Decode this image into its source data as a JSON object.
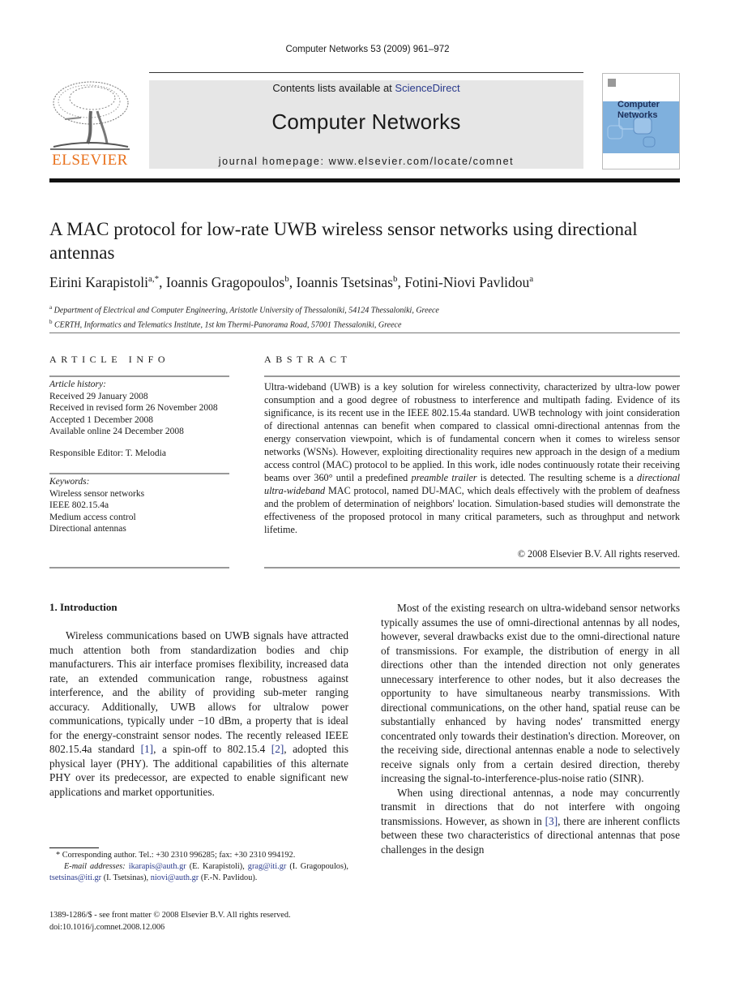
{
  "running_head": "Computer Networks 53 (2009) 961–972",
  "masthead": {
    "contents_prefix": "Contents lists available at ",
    "contents_link": "ScienceDirect",
    "journal_name": "Computer Networks",
    "homepage": "journal homepage: www.elsevier.com/locate/comnet",
    "publisher_logo_text": "ELSEVIER",
    "cover_title_line1": "Computer",
    "cover_title_line2": "Networks",
    "accent_color": "#e9711c",
    "link_color": "#2a3a8c"
  },
  "article": {
    "title": "A MAC protocol for low-rate UWB wireless sensor networks using directional antennas",
    "authors": [
      {
        "name": "Eirini Karapistoli",
        "sup": "a,*"
      },
      {
        "name": "Ioannis Gragopoulos",
        "sup": "b"
      },
      {
        "name": "Ioannis Tsetsinas",
        "sup": "b"
      },
      {
        "name": "Fotini-Niovi Pavlidou",
        "sup": "a"
      }
    ],
    "affiliations": [
      {
        "label": "a",
        "text": "Department of Electrical and Computer Engineering, Aristotle University of Thessaloniki, 54124 Thessaloniki, Greece"
      },
      {
        "label": "b",
        "text": "CERTH, Informatics and Telematics Institute, 1st km Thermi-Panorama Road, 57001 Thessaloniki, Greece"
      }
    ]
  },
  "article_info": {
    "heading": "ARTICLE INFO",
    "history_label": "Article history:",
    "history": [
      "Received 29 January 2008",
      "Received in revised form 26 November 2008",
      "Accepted 1 December 2008",
      "Available online 24 December 2008"
    ],
    "editor": "Responsible Editor: T. Melodia",
    "keywords_label": "Keywords:",
    "keywords": [
      "Wireless sensor networks",
      "IEEE 802.15.4a",
      "Medium access control",
      "Directional antennas"
    ]
  },
  "abstract": {
    "heading": "ABSTRACT",
    "part1": "Ultra-wideband (UWB) is a key solution for wireless connectivity, characterized by ultra-low power consumption and a good degree of robustness to interference and multipath fading. Evidence of its significance, is its recent use in the IEEE 802.15.4a standard. UWB technology with joint consideration of directional antennas can benefit when compared to classical omni-directional antennas from the energy conservation viewpoint, which is of fundamental concern when it comes to wireless sensor networks (WSNs). However, exploiting directionality requires new approach in the design of a medium access control (MAC) protocol to be applied. In this work, idle nodes continuously rotate their receiving beams over 360° until a predefined ",
    "italic1": "preamble trailer",
    "part2": " is detected. The resulting scheme is a ",
    "italic2": "directional ultra-wideband",
    "part3": " MAC protocol, named DU-MAC, which deals effectively with the problem of deafness and the problem of determination of neighbors' location. Simulation-based studies will demonstrate the effectiveness of the proposed protocol in many critical parameters, such as throughput and network lifetime.",
    "copyright": "© 2008 Elsevier B.V. All rights reserved."
  },
  "introduction": {
    "heading": "1.  Introduction",
    "left_p1_a": "Wireless communications based on UWB signals have attracted much attention both from standardization bodies and chip manufacturers. This air interface promises flexibility, increased data rate, an extended communication range, robustness against interference, and the ability of providing sub-meter ranging accuracy. Additionally, UWB allows for ultralow power communications, typically under −10 dBm, a property that is ideal for the energy-constraint sensor nodes. The recently released IEEE 802.15.4a standard ",
    "ref1": "[1]",
    "left_p1_b": ", a spin-off to 802.15.4 ",
    "ref2": "[2]",
    "left_p1_c": ", adopted this physical layer (PHY). The additional capabilities of this alternate PHY over its predecessor, are expected to enable significant new applications and market opportunities.",
    "right_p1": "Most of the existing research on ultra-wideband sensor networks typically assumes the use of omni-directional antennas by all nodes, however, several drawbacks exist due to the omni-directional nature of transmissions. For example, the distribution of energy in all directions other than the intended direction not only generates unnecessary interference to other nodes, but it also decreases the opportunity to have simultaneous nearby transmissions. With directional communications, on the other hand, spatial reuse can be substantially enhanced by having nodes' transmitted energy concentrated only towards their destination's direction. Moreover, on the receiving side, directional antennas enable a node to selectively receive signals only from a certain desired direction, thereby increasing the signal-to-interference-plus-noise ratio (SINR).",
    "right_p2_a": "When using directional antennas, a node may concurrently transmit in directions that do not interfere with ongoing transmissions. However, as shown in ",
    "ref3": "[3]",
    "right_p2_b": ", there are inherent conflicts between these two characteristics of directional antennas that pose challenges in the design"
  },
  "footnotes": {
    "corresponding": "* Corresponding author. Tel.: +30 2310 996285; fax: +30 2310 994192.",
    "email_label": "E-mail addresses:",
    "emails": [
      {
        "address": "ikarapis@auth.gr",
        "name": "(E. Karapistoli)"
      },
      {
        "address": "grag@iti.gr",
        "name": "(I. Gragopoulos)"
      },
      {
        "address": "tsetsinas@iti.gr",
        "name": "(I. Tsetsinas)"
      },
      {
        "address": "niovi@auth.gr",
        "name": "(F.-N. Pavlidou)"
      }
    ],
    "issn": "1389-1286/$ - see front matter © 2008 Elsevier B.V. All rights reserved.",
    "doi": "doi:10.1016/j.comnet.2008.12.006"
  }
}
